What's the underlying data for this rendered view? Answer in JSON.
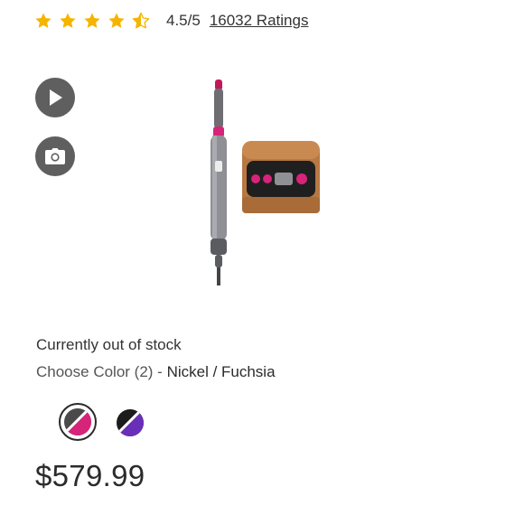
{
  "rating": {
    "stars": 4.5,
    "score_text": "4.5/5",
    "count_text": "16032 Ratings",
    "star_color": "#f5b400"
  },
  "media_buttons": [
    {
      "icon": "play-icon"
    },
    {
      "icon": "camera-icon"
    }
  ],
  "product": {
    "stock_status": "Currently out of stock",
    "choose_color_label": "Choose Color (2) - ",
    "selected_color": "Nickel / Fuchsia",
    "swatches": [
      {
        "name": "Nickel / Fuchsia",
        "colors": [
          "#4a4a4a",
          "#d6247a"
        ],
        "selected": true
      },
      {
        "name": "Black / Purple",
        "colors": [
          "#1c1c1c",
          "#6a2fb8"
        ],
        "selected": false
      }
    ],
    "price": "$579.99"
  }
}
